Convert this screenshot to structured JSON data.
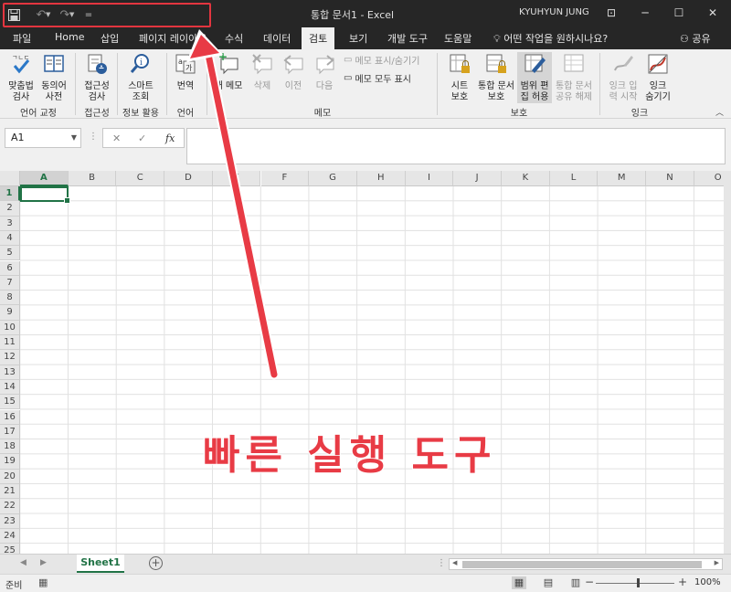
{
  "titlebar": {
    "doc_title": "통합 문서1  -  Excel",
    "user_name": "KYUHYUN JUNG",
    "qat_customize": "="
  },
  "tabs": [
    "파일",
    "Home",
    "삽입",
    "페이지 레이아웃",
    "수식",
    "데이터",
    "검토",
    "보기",
    "개발 도구",
    "도움말"
  ],
  "active_tab": "검토",
  "tell_me": "어떤 작업을 원하시나요?",
  "share": "공유",
  "ribbon": {
    "proofing": {
      "spell": "맞춤법\n검사",
      "thesaurus": "동의어\n사전",
      "label": "언어 교정"
    },
    "accessibility": {
      "check": "접근성\n검사",
      "label": "접근성"
    },
    "insights": {
      "smart": "스마트\n조회",
      "label": "정보 활용"
    },
    "language": {
      "translate": "번역",
      "label": "언어"
    },
    "comments": {
      "new": "새 메모",
      "delete": "삭제",
      "prev": "이전",
      "next": "다음",
      "show_hide": "메모 표시/숨기기",
      "show_all": "메모 모두 표시",
      "label": "메모"
    },
    "protect": {
      "sheet": "시트\n보호",
      "workbook": "통합 문서\n보호",
      "allow_edit": "범위 편\n집 허용",
      "unshare": "통합 문서\n공유 해제",
      "label": "보호"
    },
    "ink": {
      "start": "잉크 입\n력 시작",
      "hide": "잉크\n숨기기",
      "label": "잉크"
    }
  },
  "formula_bar": {
    "name_box": "A1",
    "fx": "fx",
    "cancel": "✕",
    "enter": "✓",
    "content": ""
  },
  "grid": {
    "columns": [
      "A",
      "B",
      "C",
      "D",
      "E",
      "F",
      "G",
      "H",
      "I",
      "J",
      "K",
      "L",
      "M",
      "N",
      "O"
    ],
    "rows": [
      "1",
      "2",
      "3",
      "4",
      "5",
      "6",
      "7",
      "8",
      "9",
      "10",
      "11",
      "12",
      "13",
      "14",
      "15",
      "16",
      "17",
      "18",
      "19",
      "20",
      "21",
      "22",
      "23",
      "24",
      "25"
    ],
    "selected_cell": "A1"
  },
  "sheet_tabs": {
    "active": "Sheet1",
    "add": "+"
  },
  "status": {
    "ready": "준비",
    "zoom": "100%",
    "zoom_level": 1.0
  },
  "annotation": {
    "text": "빠른 실행 도구"
  },
  "colors": {
    "accent": "#217346",
    "annotation": "#e83b45",
    "dark_chrome": "#262626"
  }
}
